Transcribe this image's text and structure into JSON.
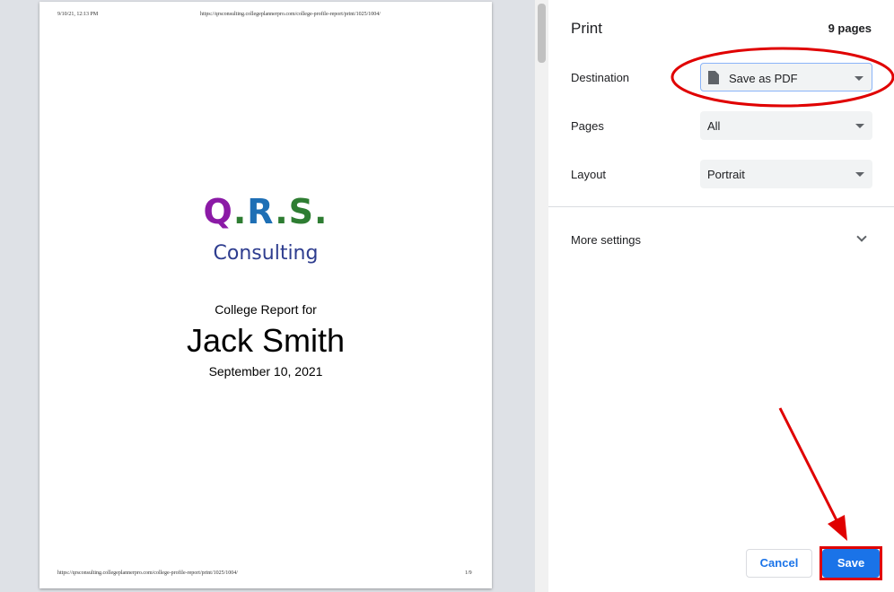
{
  "preview": {
    "header_datetime": "9/10/21, 12:13 PM",
    "header_url": "https://qrsconsulting.collegeplannerpro.com/college-profile-report/print/1025/1004/",
    "footer_url": "https://qrsconsulting.collegeplannerpro.com/college-profile-report/print/1025/1004/",
    "footer_page": "1/9",
    "logo": {
      "letters": [
        "Q",
        ".",
        "R",
        ".",
        "S",
        "."
      ],
      "letter_colors": [
        "#8b1aa6",
        "#2e7d32",
        "#1e6fb5",
        "#2e7d32",
        "#2e7d32",
        "#2e7d32"
      ],
      "subtitle": "Consulting"
    },
    "report_for": "College Report for",
    "student_name": "Jack Smith",
    "report_date": "September 10, 2021"
  },
  "panel": {
    "title": "Print",
    "page_count": "9 pages",
    "destination_label": "Destination",
    "destination_value": "Save as PDF",
    "pages_label": "Pages",
    "pages_value": "All",
    "layout_label": "Layout",
    "layout_value": "Portrait",
    "more_settings_label": "More settings",
    "cancel_label": "Cancel",
    "save_label": "Save"
  },
  "colors": {
    "accent": "#1a73e8",
    "annotation": "#e00000"
  }
}
